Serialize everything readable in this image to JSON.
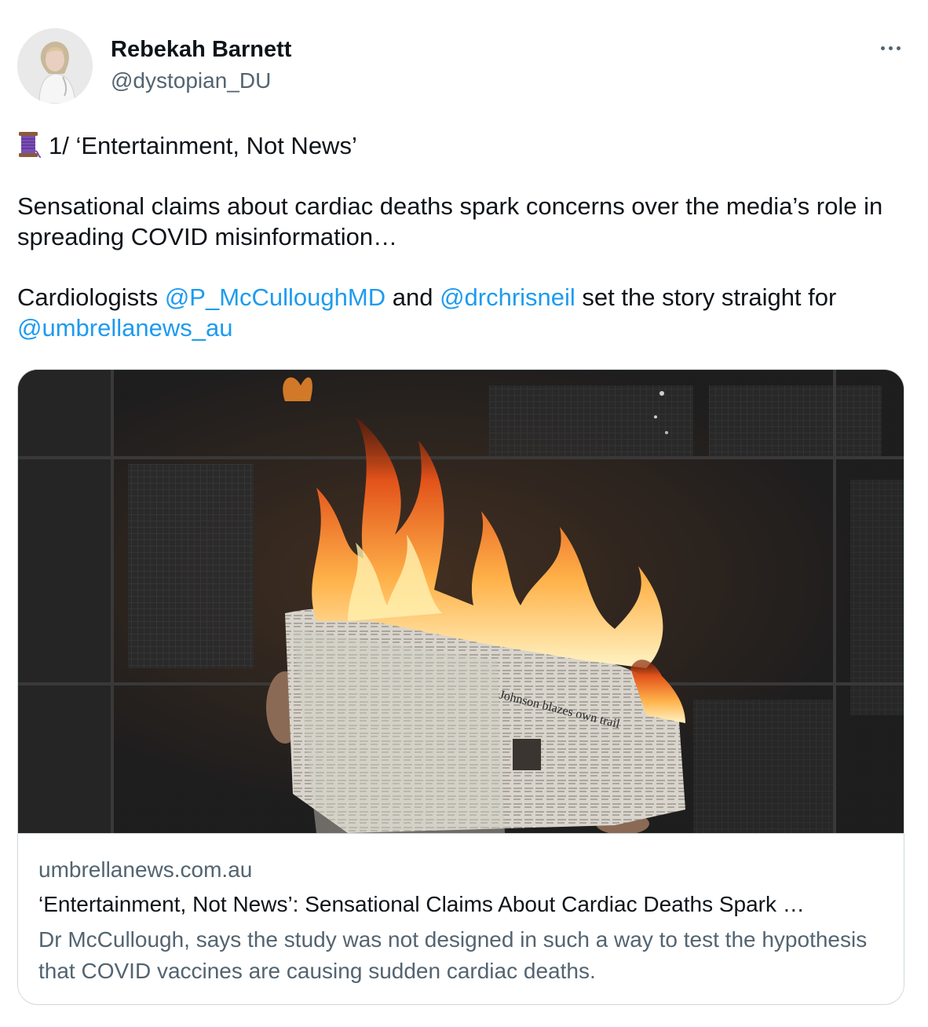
{
  "author": {
    "name": "Rebekah Barnett",
    "handle": "@dystopian_DU",
    "avatar_icon": "profile-photo"
  },
  "menu": {
    "icon": "more-horizontal-icon"
  },
  "tweet": {
    "thread_icon": "spool-of-thread-emoji",
    "line1": "1/ ‘Entertainment, Not News’",
    "para2": "Sensational claims about cardiac deaths spark concerns over the media’s role in spreading COVID misinformation…",
    "para3_prefix": "Cardiologists ",
    "mention1": "@P_McCulloughMD",
    "para3_and": " and ",
    "mention2": "@drchrisneil",
    "para3_mid": " set the story straight for ",
    "mention3": "@umbrellanews_au"
  },
  "link_card": {
    "image_icon": "burning-newspaper-photo",
    "domain": "umbrellanews.com.au",
    "title": "‘Entertainment, Not News’: Sensational Claims About Cardiac Deaths Spark …",
    "description": "Dr McCullough, says the study was not designed in such a way to test the hypothesis that COVID vaccines are causing sudden cardiac deaths."
  },
  "colors": {
    "link": "#1d9bf0",
    "text": "#0f1419",
    "secondary": "#536471",
    "border": "#cfd9de"
  }
}
